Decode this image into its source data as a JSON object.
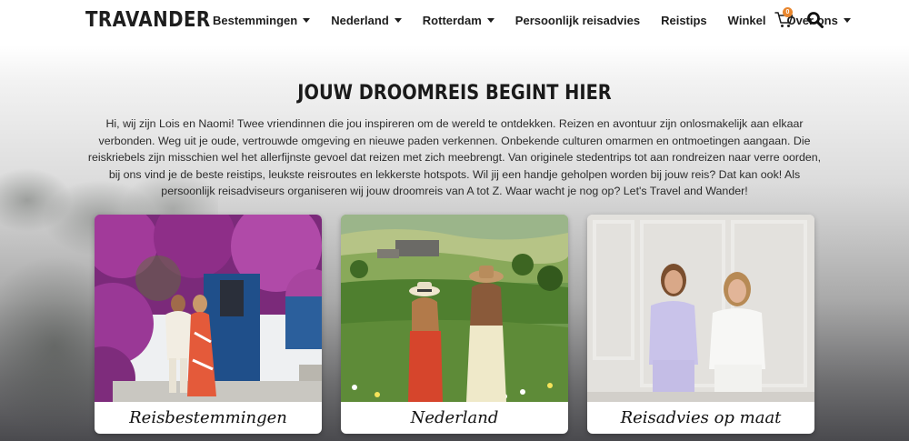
{
  "header": {
    "logo": "TRAVANDER",
    "nav": [
      {
        "label": "Bestemmingen",
        "dropdown": true
      },
      {
        "label": "Nederland",
        "dropdown": true
      },
      {
        "label": "Rotterdam",
        "dropdown": true
      },
      {
        "label": "Persoonlijk reisadvies",
        "dropdown": false
      },
      {
        "label": "Reistips",
        "dropdown": false
      },
      {
        "label": "Winkel",
        "dropdown": false
      },
      {
        "label": "Over ons",
        "dropdown": true
      }
    ],
    "cart_count": "0",
    "icons": {
      "cart": "cart-icon",
      "search": "search-icon"
    }
  },
  "hero": {
    "title": "JOUW DROOMREIS BEGINT HIER",
    "text": "Hi, wij zijn Lois en Naomi! Twee vriendinnen die jou inspireren om de wereld te ontdekken. Reizen en avontuur zijn onlosmakelijk aan elkaar verbonden. Weg uit je oude, vertrouwde omgeving en nieuwe paden verkennen. Onbekende culturen omarmen en ontmoetingen aangaan. Die reiskriebels zijn misschien wel het allerfijnste gevoel dat reizen met zich meebrengt. Van originele stedentrips tot aan rondreizen naar verre oorden, bij ons vind je de beste reistips, leukste reisroutes en lekkerste hotspots. Wil jij een handje geholpen worden bij jouw reis? Dat kan ook! Als persoonlijk reisadviseurs organiseren wij jouw droomreis van A tot Z. Waar wacht je nog op? Let's Travel and Wander!"
  },
  "cards": [
    {
      "caption": "Reisbestemmingen"
    },
    {
      "caption": "Nederland"
    },
    {
      "caption": "Reisadvies op maat"
    }
  ],
  "colors": {
    "badge": "#e8862e",
    "text": "#1e1e1e"
  }
}
